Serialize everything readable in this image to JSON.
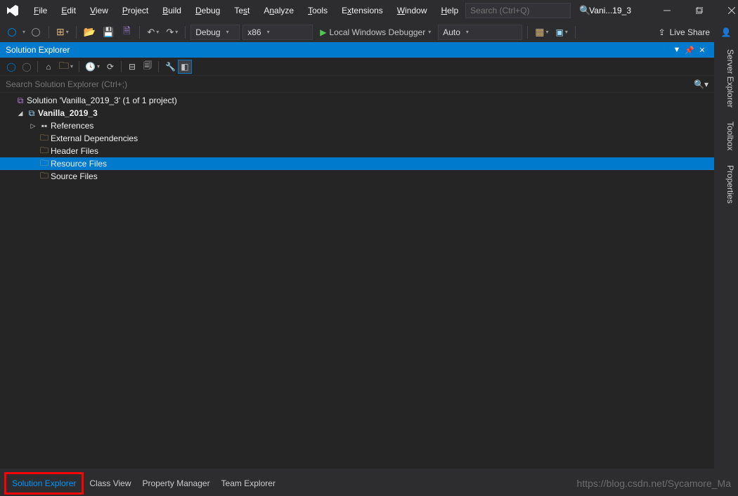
{
  "title": {
    "document": "Vani...19_3"
  },
  "menu": {
    "file": "File",
    "edit": "Edit",
    "view": "View",
    "project": "Project",
    "build": "Build",
    "debug": "Debug",
    "test": "Test",
    "analyze": "Analyze",
    "tools": "Tools",
    "extensions": "Extensions",
    "window": "Window",
    "help": "Help"
  },
  "search": {
    "placeholder": "Search (Ctrl+Q)"
  },
  "toolbar": {
    "config": "Debug",
    "platform": "x86",
    "debugger": "Local Windows Debugger",
    "auto": "Auto",
    "liveshare": "Live Share"
  },
  "panel": {
    "title": "Solution Explorer",
    "search_placeholder": "Search Solution Explorer (Ctrl+;)"
  },
  "tree": {
    "solution": "Solution 'Vanilla_2019_3' (1 of 1 project)",
    "project": "Vanilla_2019_3",
    "references": "References",
    "external_deps": "External Dependencies",
    "header_files": "Header Files",
    "resource_files": "Resource Files",
    "source_files": "Source Files"
  },
  "bottom_tabs": {
    "solution_explorer": "Solution Explorer",
    "class_view": "Class View",
    "property_manager": "Property Manager",
    "team_explorer": "Team Explorer"
  },
  "side_tabs": {
    "server_explorer": "Server Explorer",
    "toolbox": "Toolbox",
    "properties": "Properties"
  },
  "watermark": "https://blog.csdn.net/Sycamore_Ma"
}
